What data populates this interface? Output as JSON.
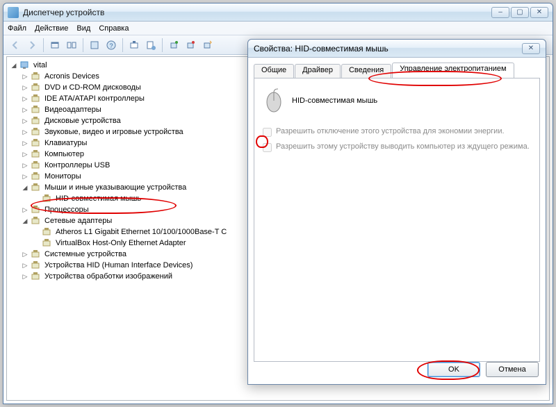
{
  "main": {
    "title": "Диспетчер устройств",
    "menu": {
      "file": "Файл",
      "action": "Действие",
      "view": "Вид",
      "help": "Справка"
    }
  },
  "tree": {
    "root": "vital",
    "items": [
      {
        "label": "Acronis Devices",
        "exp": "▷"
      },
      {
        "label": "DVD и CD-ROM дисководы",
        "exp": "▷"
      },
      {
        "label": "IDE ATA/ATAPI контроллеры",
        "exp": "▷"
      },
      {
        "label": "Видеоадаптеры",
        "exp": "▷"
      },
      {
        "label": "Дисковые устройства",
        "exp": "▷"
      },
      {
        "label": "Звуковые, видео и игровые устройства",
        "exp": "▷"
      },
      {
        "label": "Клавиатуры",
        "exp": "▷"
      },
      {
        "label": "Компьютер",
        "exp": "▷"
      },
      {
        "label": "Контроллеры USB",
        "exp": "▷"
      },
      {
        "label": "Мониторы",
        "exp": "▷"
      },
      {
        "label": "Мыши и иные указывающие устройства",
        "exp": "◢",
        "children": [
          {
            "label": "HID-совместимая мышь"
          }
        ]
      },
      {
        "label": "Процессоры",
        "exp": "▷"
      },
      {
        "label": "Сетевые адаптеры",
        "exp": "◢",
        "children": [
          {
            "label": "Atheros L1 Gigabit Ethernet 10/100/1000Base-T C"
          },
          {
            "label": "VirtualBox Host-Only Ethernet Adapter"
          }
        ]
      },
      {
        "label": "Системные устройства",
        "exp": "▷"
      },
      {
        "label": "Устройства HID (Human Interface Devices)",
        "exp": "▷"
      },
      {
        "label": "Устройства обработки изображений",
        "exp": "▷"
      }
    ]
  },
  "dialog": {
    "title": "Свойства: HID-совместимая мышь",
    "tabs": {
      "general": "Общие",
      "driver": "Драйвер",
      "details": "Сведения",
      "power": "Управление электропитанием"
    },
    "device_name": "HID-совместимая мышь",
    "opt_allow_off": "Разрешить отключение этого устройства для экономии энергии.",
    "opt_allow_wake": "Разрешить этому устройству выводить компьютер из ждущего режима.",
    "ok": "OK",
    "cancel": "Отмена"
  }
}
